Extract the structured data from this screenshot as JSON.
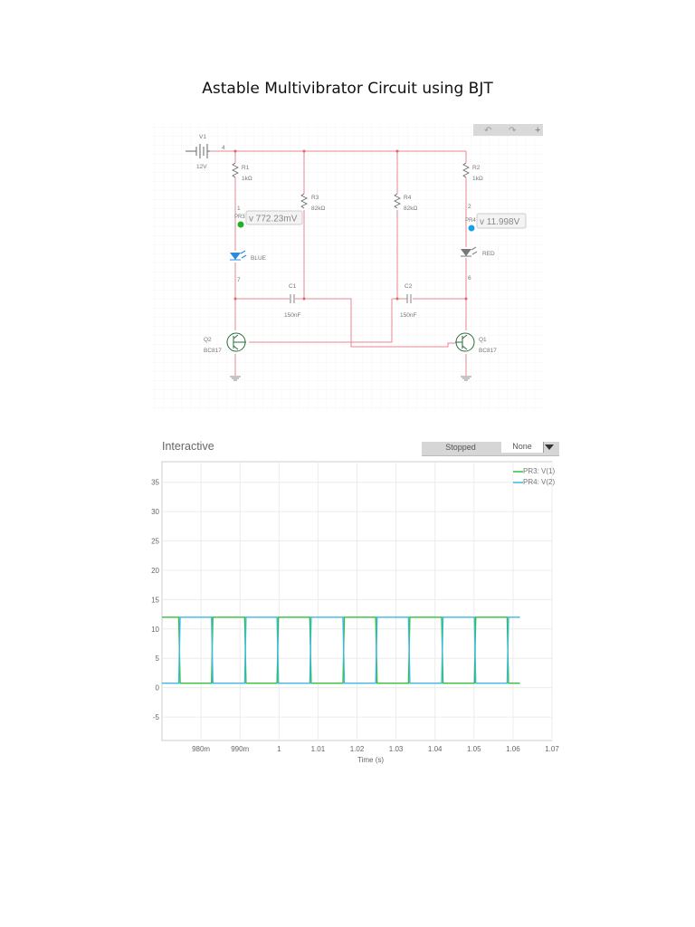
{
  "document": {
    "title": "Astable Multivibrator Circuit using BJT"
  },
  "schematic": {
    "v1": {
      "name": "V1",
      "value": "12V",
      "node": "4"
    },
    "r1": {
      "name": "R1",
      "value": "1kΩ"
    },
    "r2": {
      "name": "R2",
      "value": "1kΩ"
    },
    "r3": {
      "name": "R3",
      "value": "82kΩ"
    },
    "r4": {
      "name": "R4",
      "value": "82kΩ"
    },
    "c1": {
      "name": "C1",
      "value": "150nF"
    },
    "c2": {
      "name": "C2",
      "value": "150nF"
    },
    "q1": {
      "name": "Q1",
      "model": "BC817"
    },
    "q2": {
      "name": "Q2",
      "model": "BC817"
    },
    "led1": {
      "label": "BLUE"
    },
    "led2": {
      "label": "RED"
    },
    "nodes": {
      "n1": "1",
      "n2": "2",
      "n6": "6",
      "n7": "7"
    },
    "pr3": {
      "name": "PR3",
      "reading": "v 772.23mV",
      "color": "#22b02a"
    },
    "pr4": {
      "name": "PR4",
      "reading": "v 11.998V",
      "color": "#1aa0e6"
    }
  },
  "panel": {
    "title": "Interactive",
    "status": "Stopped",
    "dropdown": "None"
  },
  "chart_data": {
    "type": "line",
    "xlabel": "Time (s)",
    "ylabel": "",
    "xlim": [
      0.97,
      1.07
    ],
    "ylim": [
      -9,
      38.5
    ],
    "xticks": [
      0.98,
      0.99,
      1.0,
      1.01,
      1.02,
      1.03,
      1.04,
      1.05,
      1.06,
      1.07
    ],
    "xtick_labels": [
      "980m",
      "990m",
      "1",
      "1.01",
      "1.02",
      "1.03",
      "1.04",
      "1.05",
      "1.06",
      "1.07"
    ],
    "yticks": [
      35,
      30,
      25,
      20,
      15,
      10,
      5,
      0,
      -5
    ],
    "ytick_labels": [
      "35",
      "30",
      "25",
      "20",
      "15",
      "10",
      "5",
      "0",
      "-5"
    ],
    "grid": true,
    "legend": "top-right",
    "high_level": 12,
    "low_level": 0.77,
    "start": 0.97,
    "end": 1.0618,
    "transitions": [
      0.9743,
      0.9827,
      0.9912,
      0.9995,
      1.0079,
      1.0164,
      1.0248,
      1.0332,
      1.0417,
      1.0501,
      1.0585
    ],
    "series": [
      {
        "name": "PR3: V(1)",
        "color": "#2fc23a",
        "initial": "high"
      },
      {
        "name": "PR4: V(2)",
        "color": "#3cb8e6",
        "initial": "low"
      }
    ]
  }
}
